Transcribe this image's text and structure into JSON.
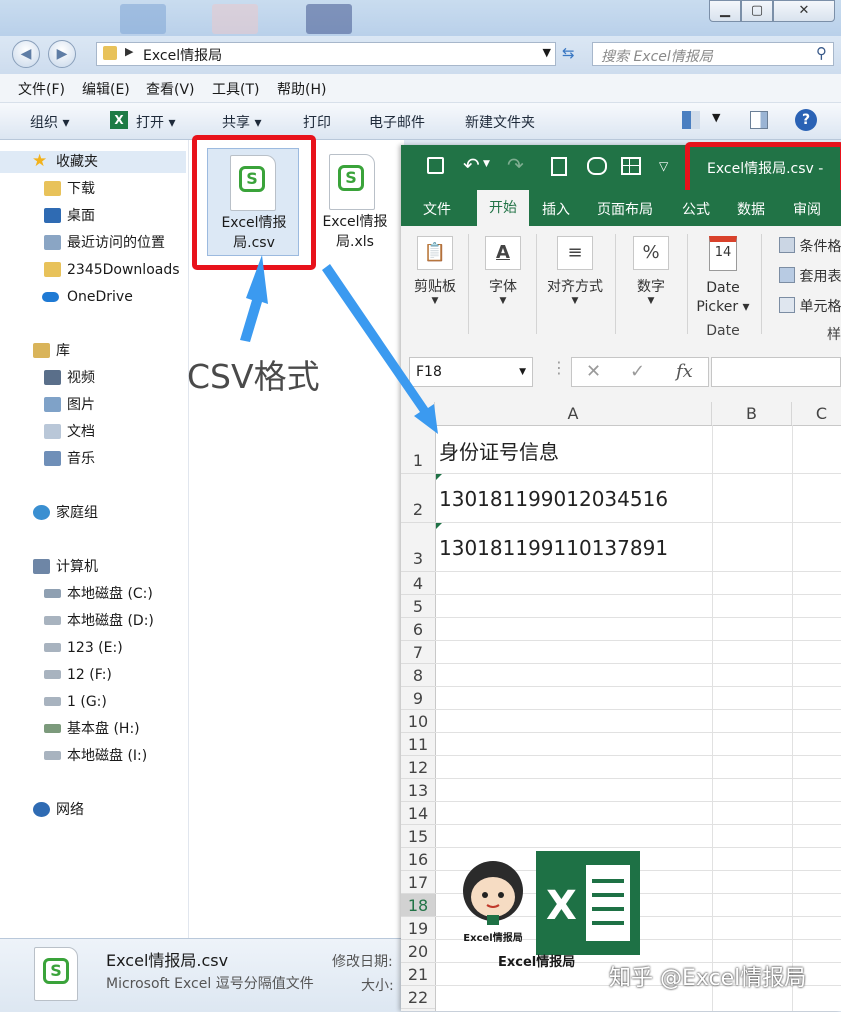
{
  "window": {
    "min": "▁",
    "max": "▢",
    "close": "✕"
  },
  "explorer": {
    "address": "Excel情报局",
    "search_placeholder": "搜索 Excel情报局",
    "menu": [
      "文件(F)",
      "编辑(E)",
      "查看(V)",
      "工具(T)",
      "帮助(H)"
    ],
    "commands": {
      "organize": "组织 ▾",
      "open": "打开 ▾",
      "share": "共享 ▾",
      "print": "打印",
      "email": "电子邮件",
      "new_folder": "新建文件夹"
    },
    "favorites": {
      "header": "收藏夹",
      "items": [
        "下载",
        "桌面",
        "最近访问的位置",
        "2345Downloads",
        "OneDrive"
      ]
    },
    "libraries": {
      "header": "库",
      "items": [
        "视频",
        "图片",
        "文档",
        "音乐"
      ]
    },
    "homegroup": "家庭组",
    "computer": {
      "header": "计算机",
      "items": [
        "本地磁盘 (C:)",
        "本地磁盘 (D:)",
        "123 (E:)",
        "12 (F:)",
        "1 (G:)",
        "基本盘 (H:)",
        "本地磁盘 (I:)"
      ]
    },
    "network": "网络",
    "files": [
      {
        "name_line1": "Excel情报",
        "name_line2": "局.csv"
      },
      {
        "name_line1": "Excel情报",
        "name_line2": "局.xls"
      }
    ],
    "status": {
      "name": "Excel情报局.csv",
      "type": "Microsoft Excel 逗号分隔值文件",
      "modified_label": "修改日期:",
      "size_label": "大小:"
    }
  },
  "annotation": {
    "csv_label": "CSV格式"
  },
  "excel": {
    "title": "Excel情报局.csv  -",
    "tabs": [
      "文件",
      "开始",
      "插入",
      "页面布局",
      "公式",
      "数据",
      "审阅"
    ],
    "ribbon": {
      "clipboard": "剪贴板",
      "font": "字体",
      "align": "对齐方式",
      "number": "数字",
      "date_line1": "Date",
      "date_line2": "Picker ▾",
      "date_group": "Date",
      "date_day": "14",
      "cond": "条件格",
      "table": "套用表",
      "cell_style": "单元格",
      "styles": "样"
    },
    "name_box": "F18",
    "columns": [
      "A",
      "B",
      "C"
    ],
    "rows": [
      "1",
      "2",
      "3",
      "4",
      "5",
      "6",
      "7",
      "8",
      "9",
      "10",
      "11",
      "12",
      "13",
      "14",
      "15",
      "16",
      "17",
      "18",
      "19",
      "20",
      "21",
      "22"
    ],
    "cells": [
      "身份证号信息",
      "130181199012034516",
      "130181199110137891"
    ]
  },
  "logo": {
    "caption": "Excel情报局",
    "badge_caption": "Excel情报局"
  },
  "watermark": "知乎 @Excel情报局",
  "colors": {
    "excel_green": "#217346",
    "annotation_red": "#e8121b",
    "arrow_blue": "#3b9af0"
  }
}
